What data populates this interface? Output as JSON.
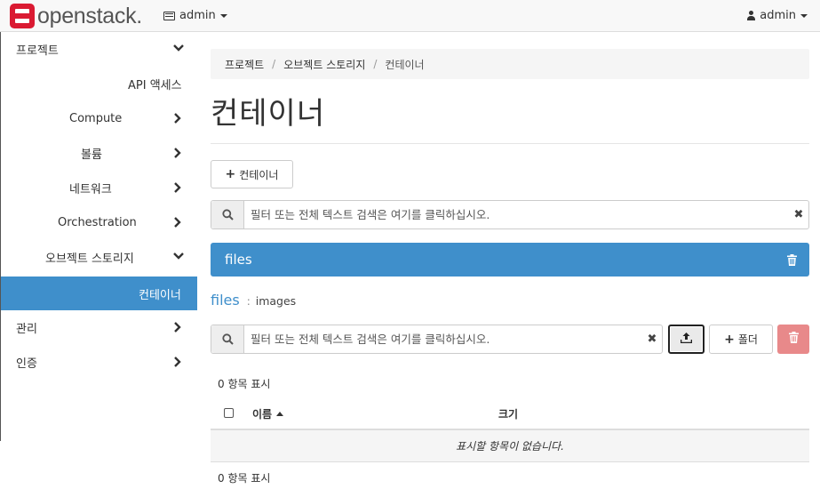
{
  "navbar": {
    "brand": "openstack.",
    "project": "admin",
    "user": "admin"
  },
  "sidebar": {
    "items": [
      {
        "label": "프로젝트"
      },
      {
        "label": "API 액세스"
      },
      {
        "label": "Compute"
      },
      {
        "label": "볼륨"
      },
      {
        "label": "네트워크"
      },
      {
        "label": "Orchestration"
      },
      {
        "label": "오브젝트 스토리지"
      },
      {
        "label": "컨테이너"
      },
      {
        "label": "관리"
      },
      {
        "label": "인증"
      }
    ]
  },
  "breadcrumb": [
    "프로젝트",
    "오브젝트 스토리지",
    "컨테이너"
  ],
  "page": {
    "title": "컨테이너",
    "create_container_label": "컨테이너",
    "container_search_placeholder": "필터 또는 전체 텍스트 검색은 여기를 클릭하십시오.",
    "selected_container": "files"
  },
  "objects": {
    "path_root": "files",
    "path_separator": ":",
    "path_sub": "images",
    "search_placeholder": "필터 또는 전체 텍스트 검색은 여기를 클릭하십시오.",
    "folder_button_label": "폴더",
    "count_top": "0 항목 표시",
    "col_name": "이름",
    "col_size": "크기",
    "empty_text": "표시할 항목이 없습니다.",
    "count_bottom": "0 항목 표시"
  },
  "colors": {
    "accent": "#3f8fcb",
    "brand_red": "#da1a32",
    "danger": "#e8898a"
  }
}
